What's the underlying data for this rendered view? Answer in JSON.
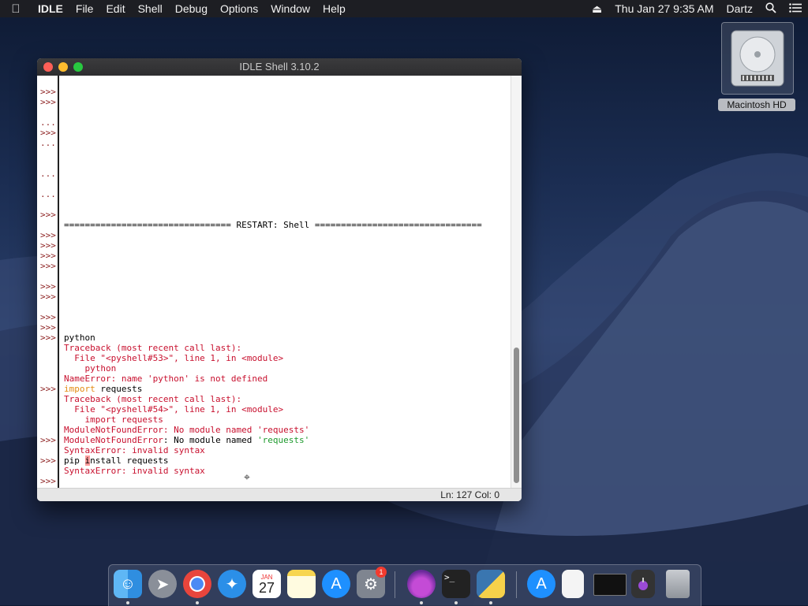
{
  "menubar": {
    "apple_icon": "apple-logo",
    "app_name": "IDLE",
    "menus": [
      "File",
      "Edit",
      "Shell",
      "Debug",
      "Options",
      "Window",
      "Help"
    ],
    "datetime": "Thu Jan 27  9:35 AM",
    "user": "Dartz"
  },
  "desktop": {
    "drive_label": "Macintosh HD"
  },
  "window": {
    "title": "IDLE Shell 3.10.2",
    "status": "Ln: 127   Col: 0"
  },
  "shell": {
    "prompts": [
      ">>>",
      ">>>",
      "...",
      ">>>",
      "...",
      "...",
      "...",
      ">>>",
      ">>>",
      ">>>",
      ">>>",
      ">>>",
      ">>>",
      ">>>",
      ">>>",
      ">>>",
      ">>>",
      ">>>",
      ">>>",
      ">>>"
    ],
    "restart_line": "================================ RESTART: Shell ================================",
    "line_python": "python",
    "tb1_header": "Traceback (most recent call last):",
    "tb1_file": "  File \"<pyshell#53>\", line 1, in <module>",
    "tb1_code": "    python",
    "tb1_error": "NameError: name 'python' is not defined",
    "import_kw": "import",
    "import_rest": " requests",
    "tb2_header": "Traceback (most recent call last):",
    "tb2_file": "  File \"<pyshell#54>\", line 1, in <module>",
    "tb2_code": "    import requests",
    "tb2_error": "ModuleNotFoundError: No module named 'requests'",
    "echo_err_label": "ModuleNotFoundError",
    "echo_mid": ": No module named ",
    "echo_str": "'requests'",
    "syntax_err1": "SyntaxError: invalid syntax",
    "pip_pre": "pip ",
    "pip_sel": "i",
    "pip_post": "nstall requests",
    "syntax_err2": "SyntaxError: invalid syntax"
  },
  "dock": {
    "apps": [
      "finder",
      "launchpad",
      "chrome",
      "safari",
      "calendar",
      "notes",
      "app-store",
      "system-preferences",
      "python-launcher",
      "terminal",
      "python-idle",
      "app-store-2",
      "document",
      "screen-window",
      "python-file",
      "trash"
    ],
    "calendar_month": "JAN",
    "calendar_day": "27",
    "sys_pref_badge": "1"
  }
}
